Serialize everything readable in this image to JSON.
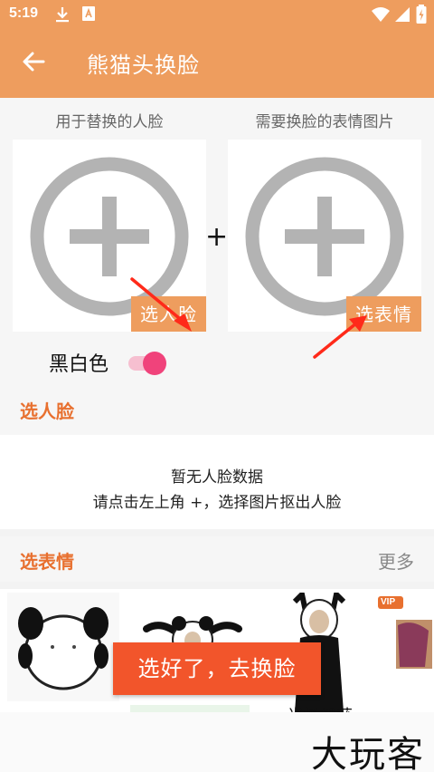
{
  "status_bar": {
    "time": "5:19",
    "icons": [
      "download-icon",
      "font-icon",
      "wifi-icon",
      "signal-icon",
      "battery-icon"
    ]
  },
  "app_bar": {
    "title": "熊猫头换脸",
    "back_icon": "back-arrow-icon"
  },
  "face_column": {
    "label": "用于替换的人脸",
    "button": "选人脸"
  },
  "expression_column": {
    "label": "需要换脸的表情图片",
    "button": "选表情"
  },
  "plus_sign": "+",
  "bw_toggle": {
    "label": "黑白色",
    "on": true
  },
  "face_section": {
    "title": "选人脸",
    "empty_line1": "暂无人脸数据",
    "empty_line2": "请点击左上角 +，选择图片抠出人脸"
  },
  "expression_section": {
    "title": "选表情",
    "more": "更多",
    "partial_caption": "当场抓获",
    "vip_badge": "VIP"
  },
  "confirm_button": "选好了，去换脸",
  "watermark": "大玩客",
  "colors": {
    "accent": "#ee9d5e",
    "section_title": "#e8702f",
    "confirm": "#f2552b",
    "toggle_thumb": "#f0437b",
    "arrow": "#ff2a1a"
  }
}
